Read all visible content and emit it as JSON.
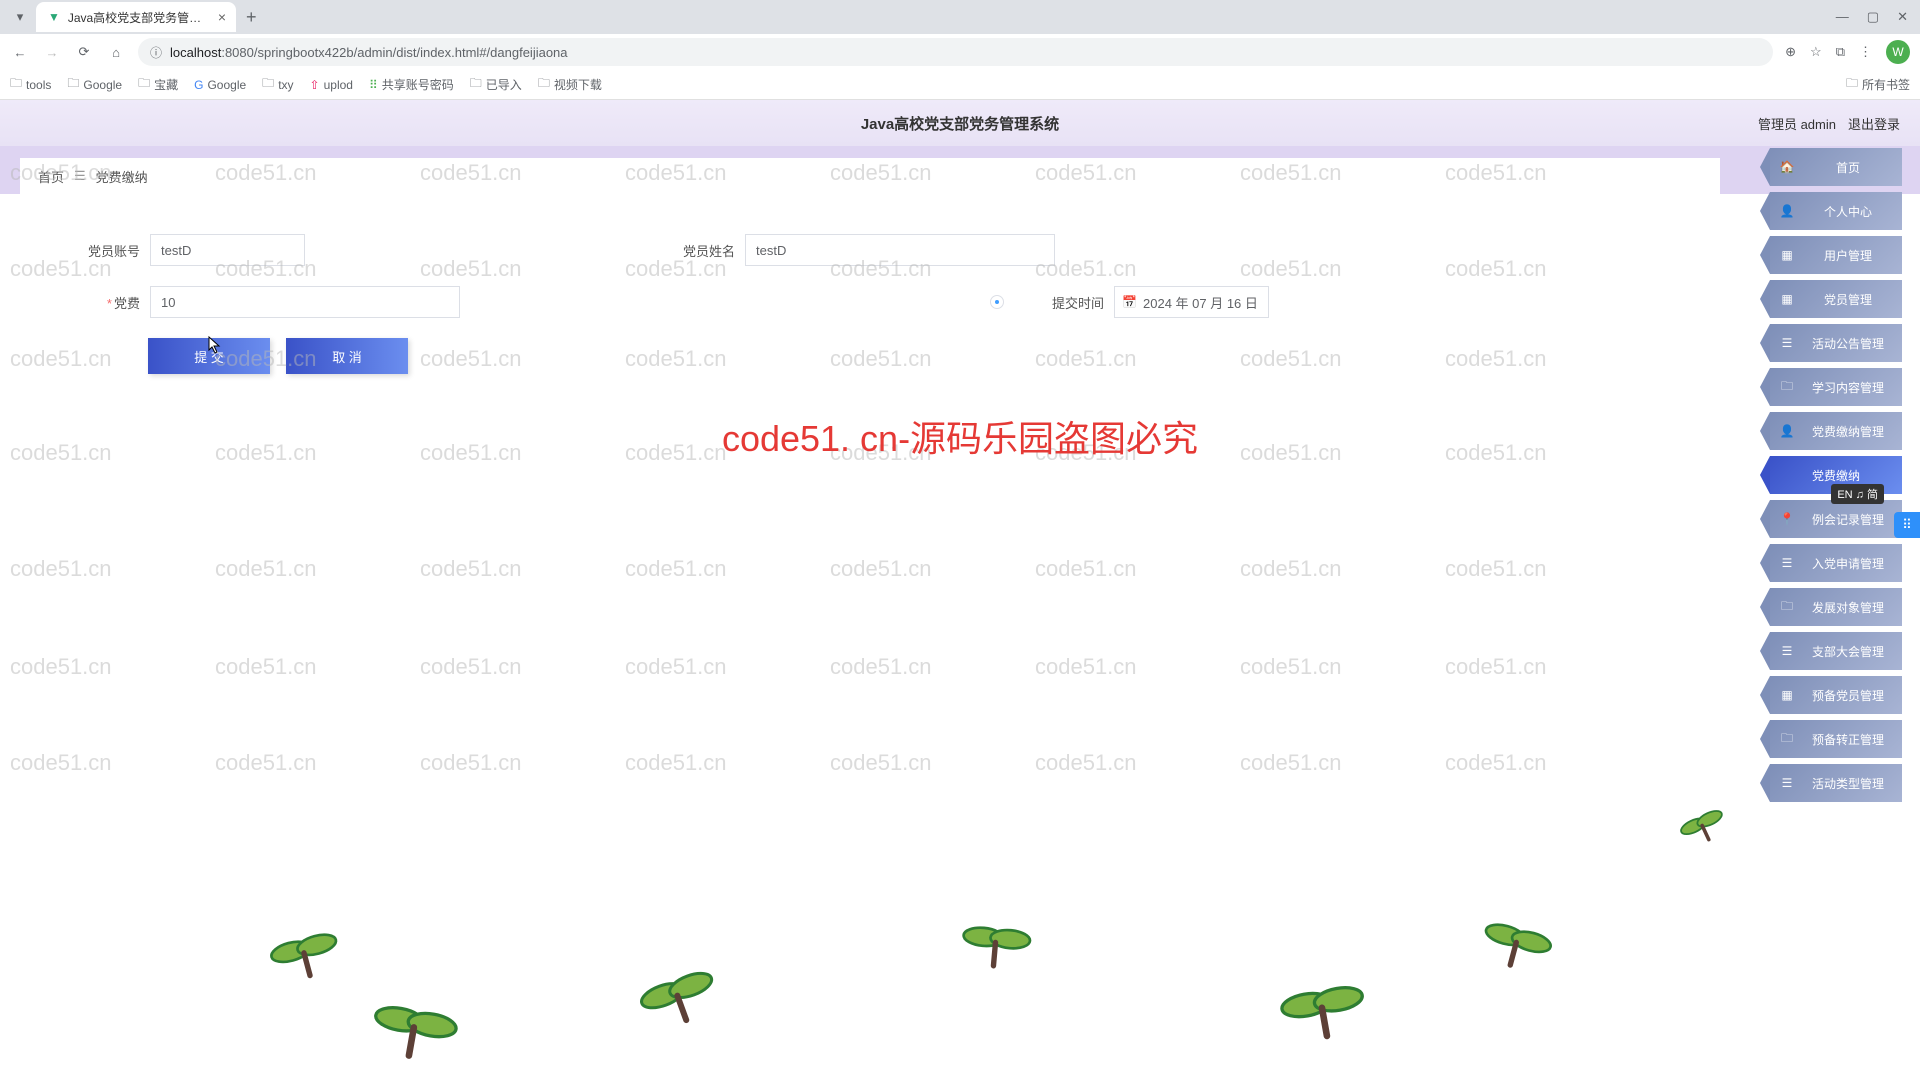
{
  "browser": {
    "tab_title": "Java高校党支部党务管理系统",
    "url_host": "localhost",
    "url_rest": ":8080/springbootx422b/admin/dist/index.html#/dangfeijiaona",
    "bookmarks": [
      "tools",
      "Google",
      "宝藏",
      "Google",
      "txy",
      "uplod",
      "共享账号密码",
      "已导入",
      "视频下载"
    ],
    "all_bookmarks": "所有书签",
    "avatar": "W"
  },
  "header": {
    "title": "Java高校党支部党务管理系统",
    "user": "管理员 admin",
    "logout": "退出登录"
  },
  "breadcrumb": {
    "home": "首页",
    "current": "党费缴纳"
  },
  "form": {
    "account_label": "党员账号",
    "account_value": "testD",
    "name_label": "党员姓名",
    "name_value": "testD",
    "fee_label": "党费",
    "fee_value": "10",
    "time_label": "提交时间",
    "time_value": "2024 年 07 月 16 日",
    "submit": "提 交",
    "cancel": "取 消"
  },
  "sidebar": [
    {
      "icon": "home",
      "label": "首页"
    },
    {
      "icon": "person",
      "label": "个人中心"
    },
    {
      "icon": "grid",
      "label": "用户管理"
    },
    {
      "icon": "grid",
      "label": "党员管理"
    },
    {
      "icon": "list",
      "label": "活动公告管理"
    },
    {
      "icon": "folder",
      "label": "学习内容管理"
    },
    {
      "icon": "person",
      "label": "党费缴纳管理"
    },
    {
      "icon": "",
      "label": "党费缴纳",
      "active": true
    },
    {
      "icon": "pin",
      "label": "例会记录管理"
    },
    {
      "icon": "list",
      "label": "入党申请管理"
    },
    {
      "icon": "folder",
      "label": "发展对象管理"
    },
    {
      "icon": "list",
      "label": "支部大会管理"
    },
    {
      "icon": "grid",
      "label": "预备党员管理"
    },
    {
      "icon": "folder",
      "label": "预备转正管理"
    },
    {
      "icon": "list",
      "label": "活动类型管理"
    }
  ],
  "lang_badge": "EN ♫ 简",
  "center_watermark": "code51. cn-源码乐园盗图必究",
  "watermark_text": "code51.cn"
}
